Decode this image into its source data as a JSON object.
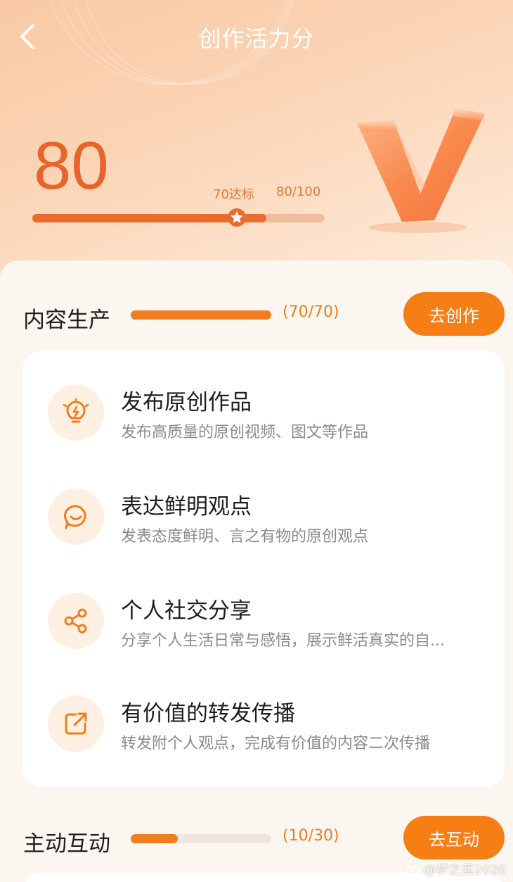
{
  "header": {
    "title": "创作活力分"
  },
  "score": {
    "value": "80",
    "standard_label": "70达标",
    "progress_label": "80/100",
    "progress_fraction": 0.8,
    "standard_fraction": 0.7
  },
  "sections": [
    {
      "title": "内容生产",
      "count": "(70/70)",
      "progress_fraction": 1.0,
      "button": "去创作",
      "tasks": [
        {
          "title": "发布原创作品",
          "desc": "发布高质量的原创视频、图文等作品",
          "icon": "lightbulb-icon"
        },
        {
          "title": "表达鲜明观点",
          "desc": "发表态度鲜明、言之有物的原创观点",
          "icon": "chat-bubble-icon"
        },
        {
          "title": "个人社交分享",
          "desc": "分享个人生活日常与感悟，展示鲜活真实的自...",
          "icon": "share-icon"
        },
        {
          "title": "有价值的转发传播",
          "desc": "转发附个人观点，完成有价值的内容二次传播",
          "icon": "forward-icon"
        }
      ]
    },
    {
      "title": "主动互动",
      "count": "(10/30)",
      "progress_fraction": 0.333,
      "button": "去互动"
    }
  ],
  "watermark": "@梦之蓝2026",
  "colors": {
    "accent": "#f57e15",
    "score": "#e8642a",
    "track": "#efe6df"
  }
}
